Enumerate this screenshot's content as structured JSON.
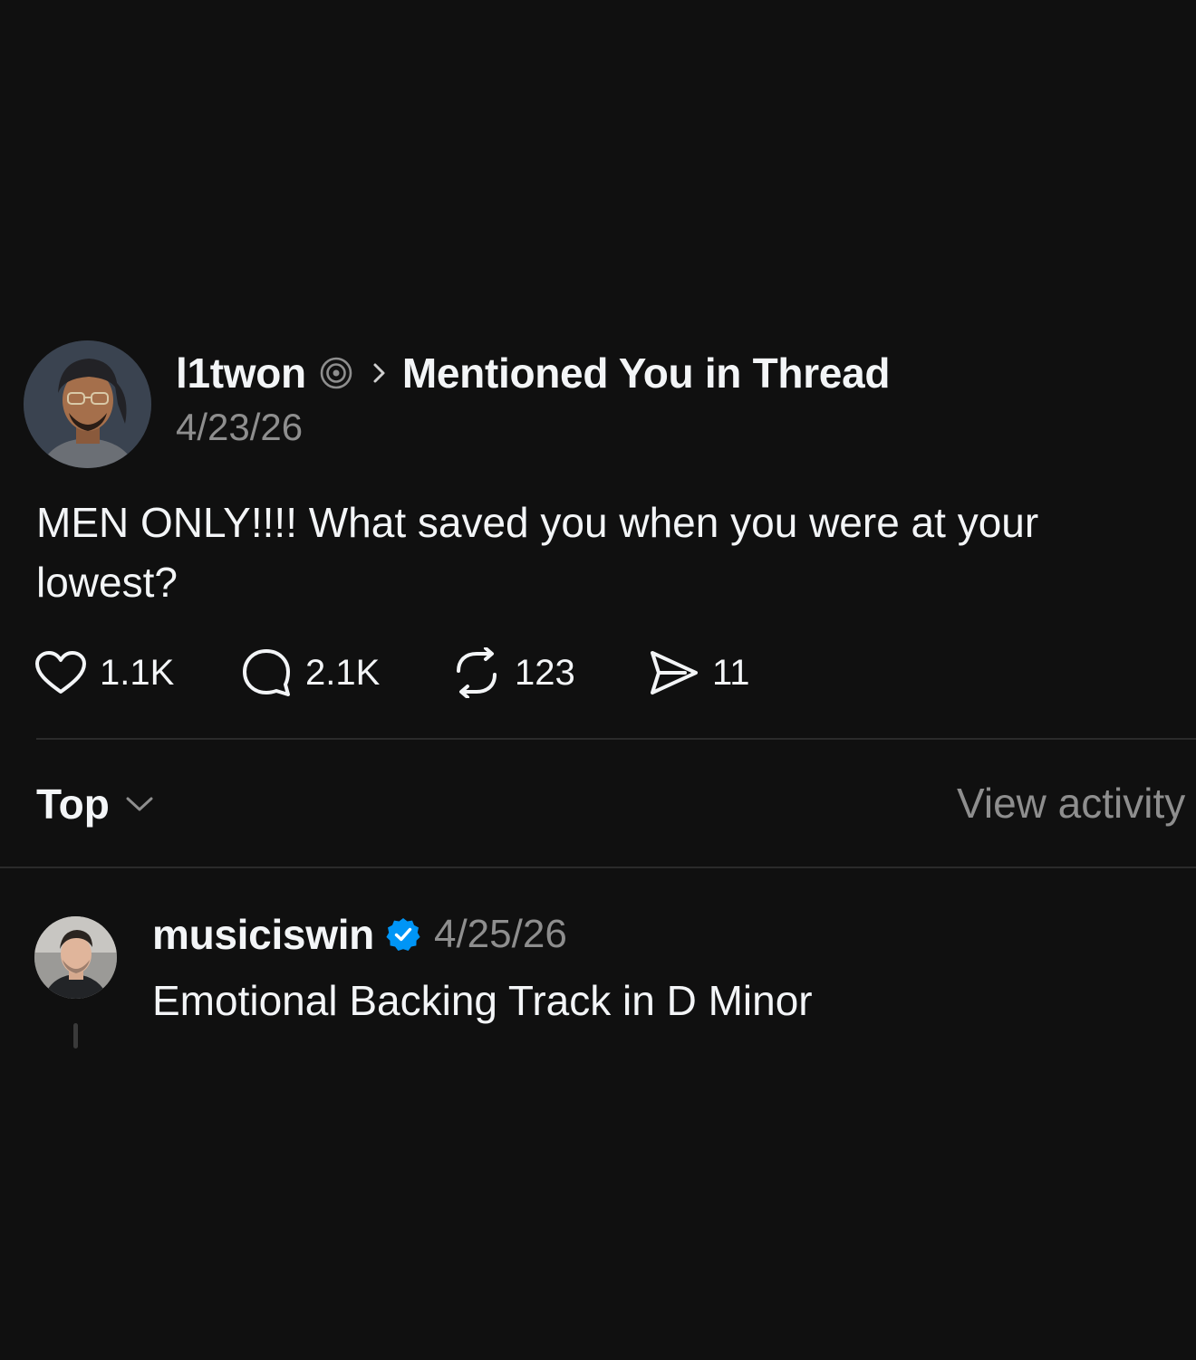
{
  "post": {
    "username": "l1twon",
    "context": "Mentioned You in Thread",
    "date": "4/23/26",
    "text": "MEN ONLY!!!! What saved you when you were at your lowest?",
    "actions": {
      "likes": "1.1K",
      "replies": "2.1K",
      "reposts": "123",
      "shares": "11"
    }
  },
  "sort": {
    "label": "Top",
    "view_activity": "View activity"
  },
  "reply": {
    "username": "musiciswin",
    "verified": true,
    "date": "4/25/26",
    "text": "Emotional Backing Track in D Minor"
  },
  "icons": {
    "like": "heart-icon",
    "reply": "comment-bubble-icon",
    "repost": "repost-icon",
    "share": "send-icon",
    "badge": "threads-badge-icon",
    "verified": "verified-checkmark-icon"
  },
  "colors": {
    "background": "#101010",
    "primary_text": "#f3f5f7",
    "secondary_text": "#8e8e8e",
    "divider": "#2b2b2b",
    "verified_blue": "#0095f6"
  }
}
